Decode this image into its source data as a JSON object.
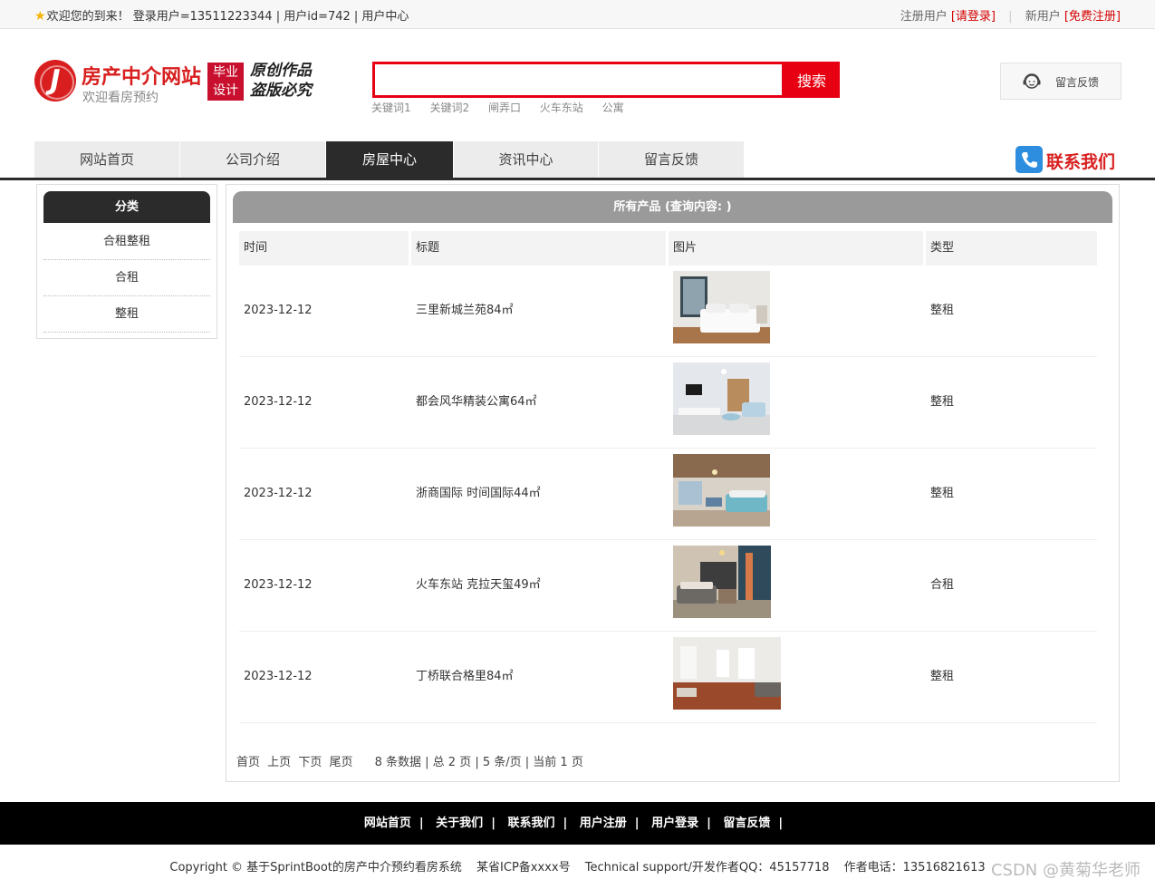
{
  "topbar": {
    "welcome": "欢迎您的到来！ 登录用户=13511223344 | 用户id=742 | 用户中心",
    "register_prefix": "注册用户",
    "login_link": "[请登录]",
    "new_user_prefix": "新用户",
    "register_link": "[免费注册]"
  },
  "header": {
    "logo_letter": "J",
    "site_name": "房产中介网站",
    "slogan": "欢迎看房预约",
    "badge_line1": "毕业",
    "badge_line2": "设计",
    "stamp_line1": "原创作品",
    "stamp_line2": "盗版必究",
    "search_placeholder": "",
    "search_button": "搜索",
    "keywords": [
      "关键词1",
      "关键词2",
      "闸弄口",
      "火车东站",
      "公寓"
    ],
    "feedback_button": "留言反馈"
  },
  "nav": {
    "items": [
      "网站首页",
      "公司介绍",
      "房屋中心",
      "资讯中心",
      "留言反馈"
    ],
    "active_index": 2,
    "contact": "联系我们"
  },
  "sidebar": {
    "title": "分类",
    "categories": [
      "合租整租",
      "合租",
      "整租"
    ]
  },
  "main": {
    "title": "所有产品 (查询内容: )",
    "columns": [
      "时间",
      "标题",
      "图片",
      "类型"
    ],
    "rows": [
      {
        "date": "2023-12-12",
        "title": "三里新城兰苑84㎡",
        "type": "整租",
        "image": "bedroom-photo"
      },
      {
        "date": "2023-12-12",
        "title": "都会风华精装公寓64㎡",
        "type": "整租",
        "image": "living-room-photo"
      },
      {
        "date": "2023-12-12",
        "title": "浙商国际 时间国际44㎡",
        "type": "整租",
        "image": "studio-photo"
      },
      {
        "date": "2023-12-12",
        "title": "火车东站 克拉天玺49㎡",
        "type": "合租",
        "image": "bedroom-dark-photo"
      },
      {
        "date": "2023-12-12",
        "title": "丁桥联合格里84㎡",
        "type": "整租",
        "image": "empty-room-photo"
      }
    ],
    "pager": {
      "first": "首页",
      "prev": "上页",
      "next": "下页",
      "last": "尾页",
      "info": "8 条数据 | 总 2 页 | 5 条/页 | 当前 1 页"
    }
  },
  "footer": {
    "links": [
      "网站首页",
      "关于我们",
      "联系我们",
      "用户注册",
      "用户登录",
      "留言反馈"
    ],
    "separator": "|",
    "copyright": "Copyright © 基于SprintBoot的房产中介预约看房系统",
    "icp": "某省ICP备xxxx号",
    "support": "Technical support/开发作者QQ：45157718",
    "phone": "作者电话：13516821613",
    "watermark": "CSDN @黄菊华老师"
  },
  "colors": {
    "accent_red": "#e60012",
    "nav_dark": "#2b2b2b",
    "panel_header": "#9a9a9a",
    "footer_bg": "#000000"
  }
}
